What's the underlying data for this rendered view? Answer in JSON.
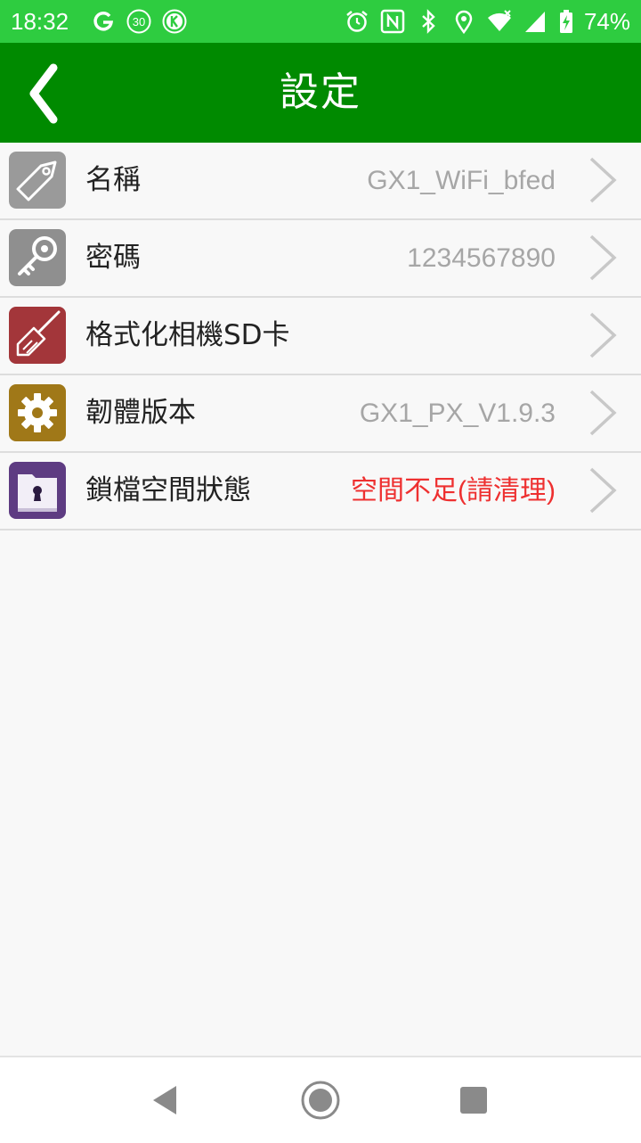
{
  "status_bar": {
    "time": "18:32",
    "left_icons": [
      "g-icon",
      "thirty-badge-icon",
      "k-badge-icon"
    ],
    "right_icons": [
      "alarm-icon",
      "nfc-icon",
      "bluetooth-icon",
      "location-icon",
      "wifi-icon",
      "cell-signal-icon",
      "battery-charging-icon"
    ],
    "battery": "74%"
  },
  "app_bar": {
    "title": "設定",
    "back_icon": "chevron-left-icon"
  },
  "settings": {
    "items": [
      {
        "label": "名稱",
        "value": "GX1_WiFi_bfed",
        "icon": "tag-icon",
        "icon_color": "#9a9a9a"
      },
      {
        "label": "密碼",
        "value": "1234567890",
        "icon": "key-icon",
        "icon_color": "#8f8f8f"
      },
      {
        "label": "格式化相機SD卡",
        "value": "",
        "icon": "broom-icon",
        "icon_color": "#a3363a"
      },
      {
        "label": "韌體版本",
        "value": "GX1_PX_V1.9.3",
        "icon": "gear-icon",
        "icon_color": "#a07818"
      },
      {
        "label": "鎖檔空間狀態",
        "value": "空間不足(請清理)",
        "icon": "locked-folder-icon",
        "icon_color": "#5e3c82",
        "value_color": "#ee3030"
      }
    ]
  },
  "nav_bar": {
    "buttons": [
      "back-triangle-icon",
      "home-circle-icon",
      "recents-square-icon"
    ]
  },
  "colors": {
    "status_bar": "#2ecc40",
    "app_bar": "#008a00",
    "background": "#f8f8f8",
    "value_text": "#a6a6a6",
    "warning_text": "#ee3030"
  }
}
